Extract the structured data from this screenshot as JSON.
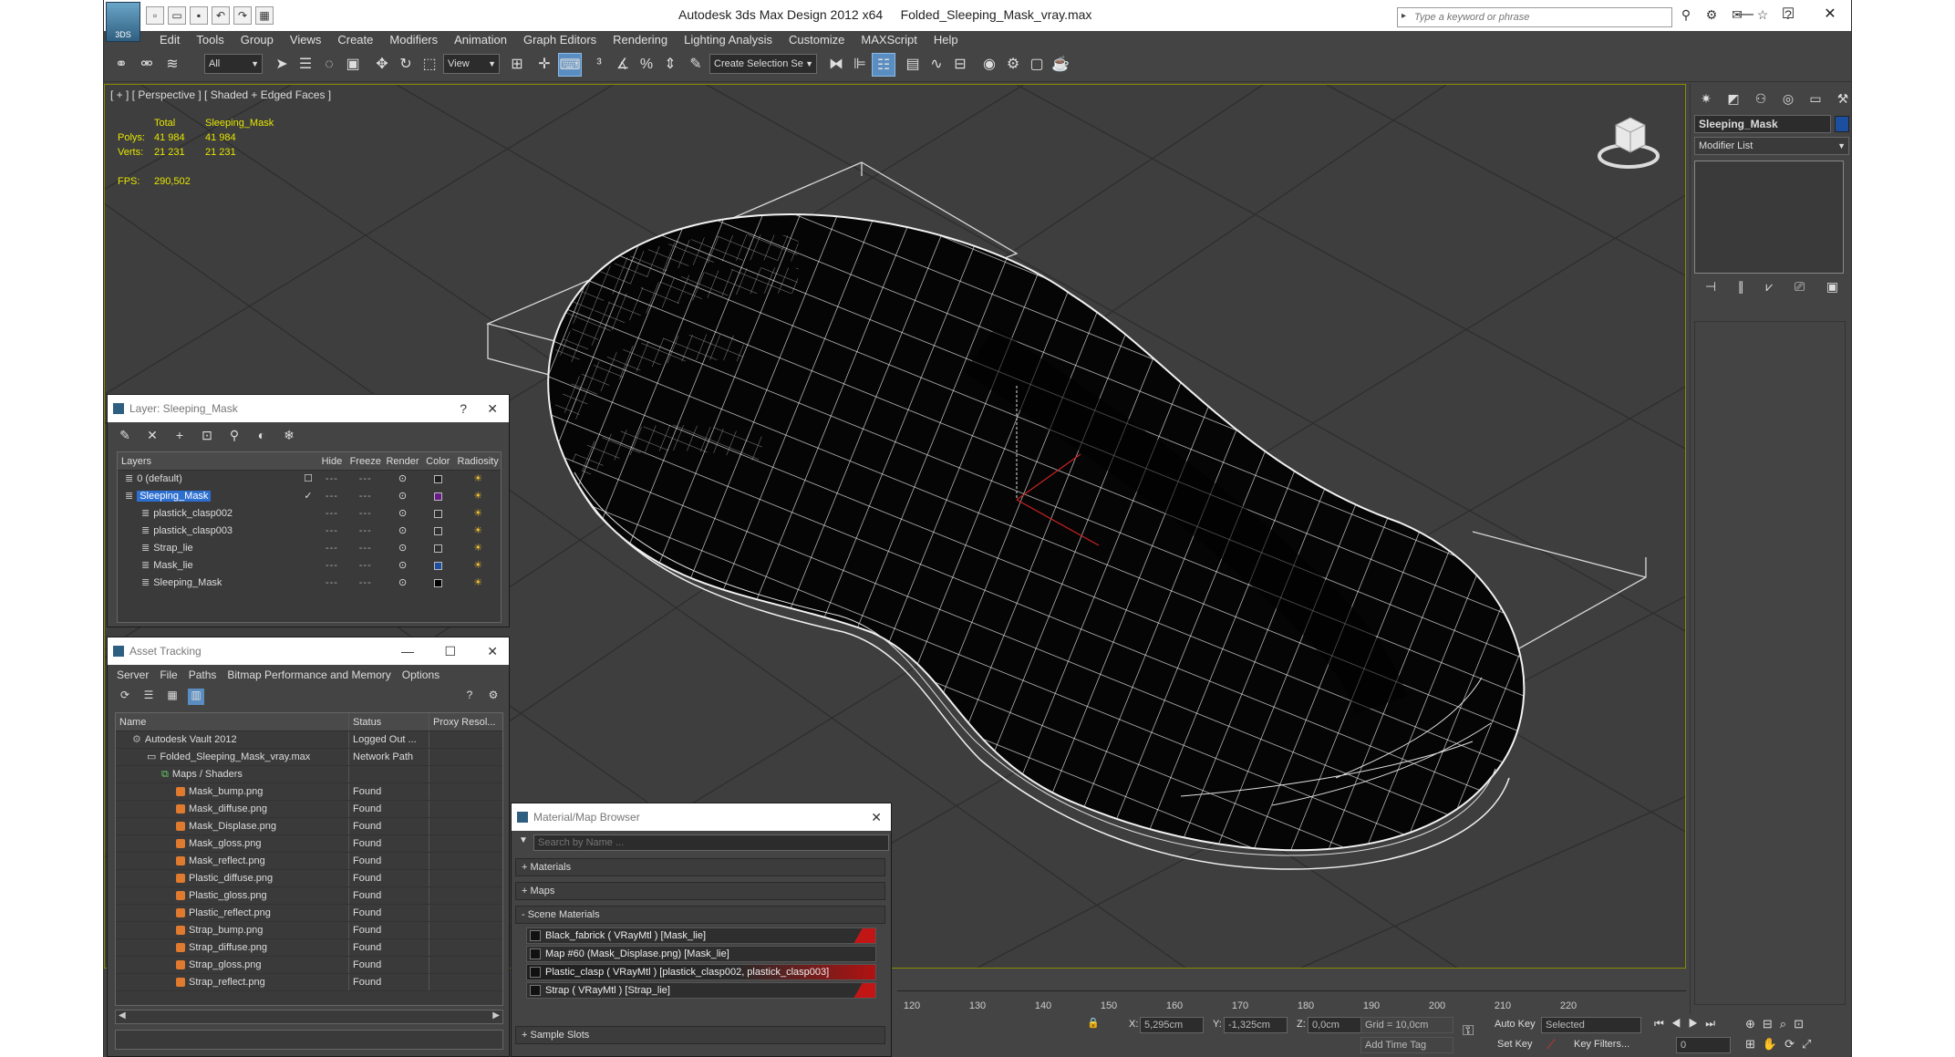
{
  "titlebar": {
    "app_logo_text": "3DS",
    "title": "Autodesk 3ds Max Design 2012 x64     Folded_Sleeping_Mask_vray.max",
    "search_placeholder": "Type a keyword or phrase",
    "quick_access": [
      "new-icon",
      "open-icon",
      "save-icon",
      "undo-icon",
      "redo-icon",
      "project-icon"
    ],
    "window_controls": [
      "minimize-icon",
      "maximize-icon",
      "close-icon"
    ]
  },
  "menu": [
    "Edit",
    "Tools",
    "Group",
    "Views",
    "Create",
    "Modifiers",
    "Animation",
    "Graph Editors",
    "Rendering",
    "Lighting Analysis",
    "Customize",
    "MAXScript",
    "Help"
  ],
  "toolbar": {
    "filter_select": "All",
    "ref_coord_select": "View",
    "named_selection": "Create Selection Se"
  },
  "viewport": {
    "label": "[ + ] [ Perspective ] [ Shaded + Edged Faces ]",
    "stats": {
      "header_total": "Total",
      "header_object": "Sleeping_Mask",
      "polys_label": "Polys:",
      "polys_total": "41 984",
      "polys_object": "41 984",
      "verts_label": "Verts:",
      "verts_total": "21 231",
      "verts_object": "21 231",
      "fps_label": "FPS:",
      "fps_value": "290,502"
    }
  },
  "layer_dialog": {
    "title": "Layer: Sleeping_Mask",
    "help": "?",
    "close": "✕",
    "columns": {
      "layers": "Layers",
      "hide": "Hide",
      "freeze": "Freeze",
      "render": "Render",
      "color": "Color",
      "radiosity": "Radiosity"
    },
    "rows": [
      {
        "name": "0 (default)",
        "color": "#202020",
        "selected": false,
        "indent": 1
      },
      {
        "name": "Sleeping_Mask",
        "color": "#6a1a8a",
        "selected": true,
        "indent": 1
      },
      {
        "name": "plastick_clasp002",
        "color": "#303030",
        "selected": false,
        "indent": 2
      },
      {
        "name": "plastick_clasp003",
        "color": "#303030",
        "selected": false,
        "indent": 2
      },
      {
        "name": "Strap_lie",
        "color": "#303030",
        "selected": false,
        "indent": 2
      },
      {
        "name": "Mask_lie",
        "color": "#1c4fa0",
        "selected": false,
        "indent": 2
      },
      {
        "name": "Sleeping_Mask",
        "color": "#000000",
        "selected": false,
        "indent": 2
      }
    ]
  },
  "asset_dialog": {
    "title": "Asset Tracking",
    "menu": [
      "Server",
      "File",
      "Paths",
      "Bitmap Performance and Memory",
      "Options"
    ],
    "columns": {
      "name": "Name",
      "status": "Status",
      "proxy": "Proxy Resol..."
    },
    "rows": [
      {
        "name": "Autodesk Vault 2012",
        "status": "Logged Out ...",
        "indent": 1
      },
      {
        "name": "Folded_Sleeping_Mask_vray.max",
        "status": "Network Path",
        "indent": 2
      },
      {
        "name": "Maps / Shaders",
        "status": "",
        "indent": 3
      },
      {
        "name": "Mask_bump.png",
        "status": "Found",
        "indent": 4
      },
      {
        "name": "Mask_diffuse.png",
        "status": "Found",
        "indent": 4
      },
      {
        "name": "Mask_Displase.png",
        "status": "Found",
        "indent": 4
      },
      {
        "name": "Mask_gloss.png",
        "status": "Found",
        "indent": 4
      },
      {
        "name": "Mask_reflect.png",
        "status": "Found",
        "indent": 4
      },
      {
        "name": "Plastic_diffuse.png",
        "status": "Found",
        "indent": 4
      },
      {
        "name": "Plastic_gloss.png",
        "status": "Found",
        "indent": 4
      },
      {
        "name": "Plastic_reflect.png",
        "status": "Found",
        "indent": 4
      },
      {
        "name": "Strap_bump.png",
        "status": "Found",
        "indent": 4
      },
      {
        "name": "Strap_diffuse.png",
        "status": "Found",
        "indent": 4
      },
      {
        "name": "Strap_gloss.png",
        "status": "Found",
        "indent": 4
      },
      {
        "name": "Strap_reflect.png",
        "status": "Found",
        "indent": 4
      }
    ]
  },
  "material_dialog": {
    "title": "Material/Map Browser",
    "search_placeholder": "Search by Name ...",
    "groups": {
      "materials": "+ Materials",
      "maps": "+ Maps",
      "scene": "- Scene Materials",
      "samples": "+ Sample Slots"
    },
    "items": [
      {
        "label": "Black_fabrick  ( VRayMtl ) [Mask_lie]",
        "flag": "corner"
      },
      {
        "label": "Map #60 (Mask_Displase.png) [Mask_lie]",
        "flag": "none"
      },
      {
        "label": "Plastic_clasp  ( VRayMtl ) [plastick_clasp002, plastick_clasp003]",
        "flag": "full"
      },
      {
        "label": "Strap  ( VRayMtl ) [Strap_lie]",
        "flag": "corner"
      }
    ]
  },
  "command_panel": {
    "object_name": "Sleeping_Mask",
    "object_color": "#1c4fa0",
    "modifier_list": "Modifier List"
  },
  "timeline": {
    "ticks": [
      "120",
      "130",
      "140",
      "150",
      "160",
      "170",
      "180",
      "190",
      "200",
      "210",
      "220"
    ]
  },
  "statusbar": {
    "x_label": "X:",
    "x_value": "5,295cm",
    "y_label": "Y:",
    "y_value": "-1,325cm",
    "z_label": "Z:",
    "z_value": "0,0cm",
    "grid": "Grid = 10,0cm",
    "auto_key": "Auto Key",
    "auto_key_select": "Selected",
    "set_key": "Set Key",
    "key_filters": "Key Filters...",
    "add_time_tag": "Add Time Tag",
    "frame_value": "0"
  }
}
